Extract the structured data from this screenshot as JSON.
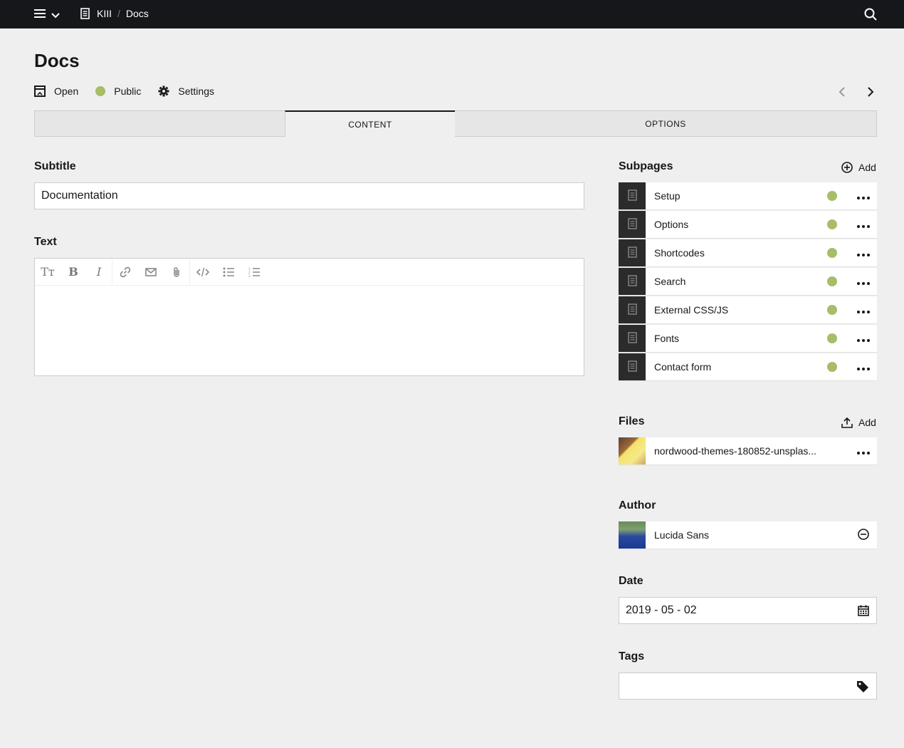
{
  "topbar": {
    "breadcrumb": [
      {
        "label": "KIII"
      },
      {
        "label": "Docs"
      }
    ]
  },
  "page": {
    "title": "Docs",
    "actions": {
      "open": "Open",
      "status": "Public",
      "settings": "Settings"
    }
  },
  "tabs": {
    "content": "CONTENT",
    "options": "OPTIONS"
  },
  "fields": {
    "subtitle": {
      "label": "Subtitle",
      "value": "Documentation"
    },
    "text": {
      "label": "Text",
      "value": ""
    },
    "subpages": {
      "label": "Subpages",
      "add_label": "Add",
      "items": [
        {
          "title": "Setup",
          "status_color": "#a7bd68"
        },
        {
          "title": "Options",
          "status_color": "#a7bd68"
        },
        {
          "title": "Shortcodes",
          "status_color": "#a7bd68"
        },
        {
          "title": "Search",
          "status_color": "#a7bd68"
        },
        {
          "title": "External CSS/JS",
          "status_color": "#a7bd68"
        },
        {
          "title": "Fonts",
          "status_color": "#a7bd68"
        },
        {
          "title": "Contact form",
          "status_color": "#a7bd68"
        }
      ]
    },
    "files": {
      "label": "Files",
      "add_label": "Add",
      "items": [
        {
          "filename": "nordwood-themes-180852-unsplas..."
        }
      ]
    },
    "author": {
      "label": "Author",
      "name": "Lucida Sans"
    },
    "date": {
      "label": "Date",
      "value": "2019 - 05 - 02"
    },
    "tags": {
      "label": "Tags",
      "value": ""
    }
  },
  "colors": {
    "topbar_bg": "#16171a",
    "page_bg": "#efefef",
    "status_public": "#a7bd68"
  }
}
